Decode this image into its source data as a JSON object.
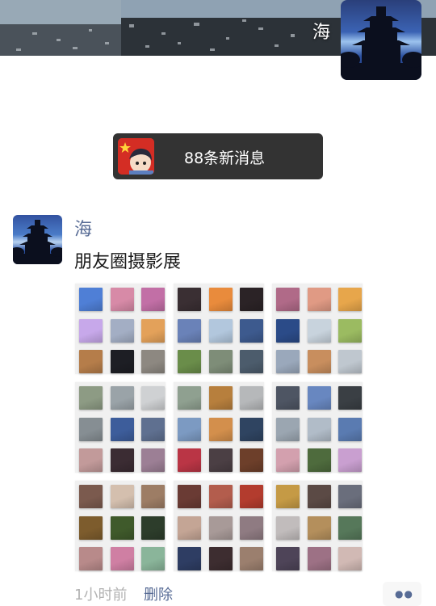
{
  "owner": {
    "name": "海"
  },
  "notification": {
    "text": "88条新消息"
  },
  "post": {
    "author": "海",
    "text": "朋友圈摄影展",
    "time": "1小时前",
    "delete_label": "删除",
    "more_icon": "two-dots-icon"
  },
  "collage": {
    "blocks": [
      [
        "#4f7fd6",
        "#d78aa7",
        "#c26fa6",
        "#c7a8ea",
        "#a3aec4",
        "#e3a15a",
        "#b57d4a",
        "#1d1e24",
        "#8d8881"
      ],
      [
        "#3a2f33",
        "#e98b3c",
        "#2b2326",
        "#6a82b8",
        "#b2c7dd",
        "#3d5a8e",
        "#6a8d4a",
        "#7e8d78",
        "#4c5c6c"
      ],
      [
        "#b06a88",
        "#e09a84",
        "#e7a64b",
        "#2b4b88",
        "#c8d3dd",
        "#9bbb61",
        "#9aa8bb",
        "#c88e5e",
        "#bfc7cf"
      ],
      [
        "#8d9b84",
        "#9aa3a8",
        "#cfd1d3",
        "#868e93",
        "#3d5d9b",
        "#5f7090",
        "#c29a9a",
        "#3b2c33",
        "#9c7f95"
      ],
      [
        "#8fa090",
        "#b77f3d",
        "#b6b8ba",
        "#7c9ac2",
        "#d38f4c",
        "#2f4461",
        "#ba3545",
        "#4b3f44",
        "#6d3f2a"
      ],
      [
        "#4e5563",
        "#6887c0",
        "#3a3f44",
        "#9ba6b1",
        "#b1bcc8",
        "#5a7bb1",
        "#d3a0ae",
        "#4e6b3d",
        "#c99fd0"
      ],
      [
        "#7b5a4e",
        "#d4bfae",
        "#9d7d65",
        "#7d5c2d",
        "#3f5a2b",
        "#2d3d2b",
        "#b88a8a",
        "#cf7fa3",
        "#8ab59a"
      ],
      [
        "#6a3b34",
        "#b35d4d",
        "#b33c2e",
        "#c4a595",
        "#a89a98",
        "#8f7b82",
        "#2e3d63",
        "#3d2d30",
        "#9b7f6e"
      ],
      [
        "#c59a45",
        "#5b4a45",
        "#6a6e7c",
        "#c1bcbc",
        "#b48f5c",
        "#56785a",
        "#4e4458",
        "#9d7185",
        "#d1b9b4"
      ]
    ]
  }
}
